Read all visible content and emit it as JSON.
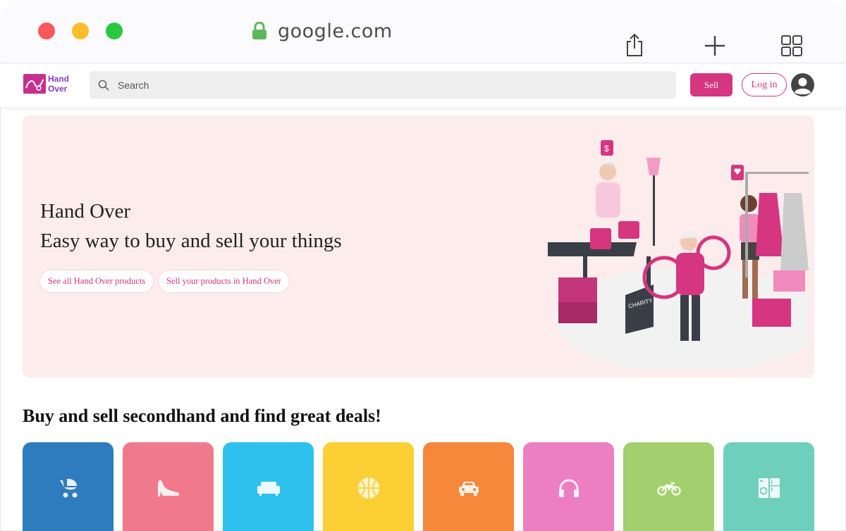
{
  "browser": {
    "url": "google.com",
    "traffic_lights": [
      "close",
      "minimize",
      "maximize"
    ],
    "actions": [
      "share-icon",
      "new-tab-icon",
      "tabs-overview-icon"
    ]
  },
  "header": {
    "logo_line1": "Hand",
    "logo_line2": "Over",
    "search_placeholder": "Search",
    "sell_label": "Sell",
    "login_label": "Log in"
  },
  "hero": {
    "title": "Hand Over",
    "subtitle": "Easy way to buy and sell your things",
    "btn_all_products": "See all Hand Over products",
    "btn_sell_products": "Sell your products in Hand Over",
    "illustration_sign": "CHARITY MARKET"
  },
  "section": {
    "title": "Buy and sell secondhand and find great deals!"
  },
  "categories": [
    {
      "icon": "baby-carriage-icon",
      "color": "#2e7bbd"
    },
    {
      "icon": "high-heel-icon",
      "color": "#f07a8b"
    },
    {
      "icon": "couch-icon",
      "color": "#2fc1ee"
    },
    {
      "icon": "basketball-icon",
      "color": "#fcd034"
    },
    {
      "icon": "car-icon",
      "color": "#f7873a"
    },
    {
      "icon": "headphones-icon",
      "color": "#ec7fc1"
    },
    {
      "icon": "motorcycle-icon",
      "color": "#a4cf6f"
    },
    {
      "icon": "appliances-icon",
      "color": "#6ecfbc"
    }
  ],
  "colors": {
    "accent": "#d6357f",
    "hero_bg": "#fdecec"
  }
}
